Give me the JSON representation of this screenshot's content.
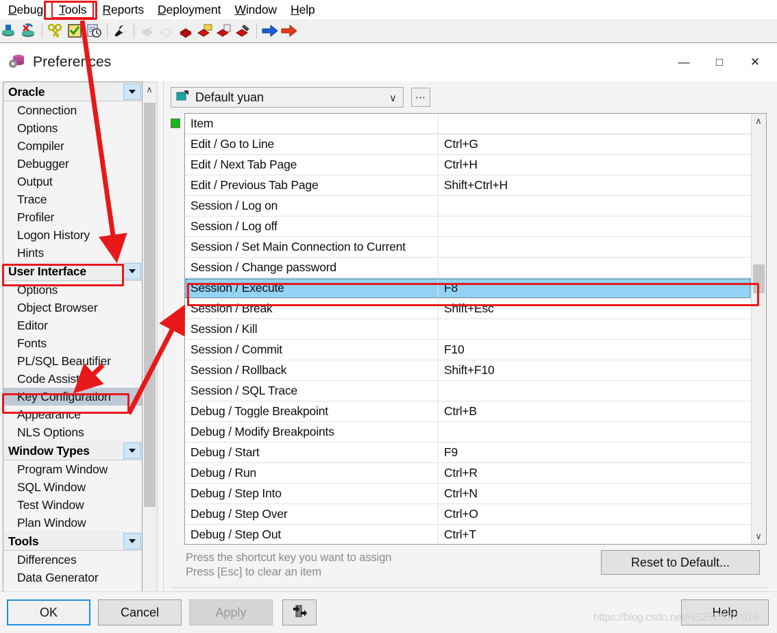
{
  "app": {
    "menubar": [
      {
        "label": "Debug",
        "accel": "D",
        "highlighted": false
      },
      {
        "label": "Tools",
        "accel": "T",
        "highlighted": true
      },
      {
        "label": "Reports",
        "accel": "R",
        "highlighted": false
      },
      {
        "label": "Deployment",
        "accel": "D",
        "highlighted": false
      },
      {
        "label": "Window",
        "accel": "W",
        "highlighted": false
      },
      {
        "label": "Help",
        "accel": "H",
        "highlighted": false
      }
    ],
    "toolbar_icons": [
      "save-icon",
      "save-all-icon",
      "sep",
      "keys-icon",
      "test-script-icon",
      "explain-plan-icon",
      "sep",
      "wrench-icon",
      "sep",
      "new-object-disabled-icon",
      "open-disabled-icon",
      "books-icon",
      "book-folder-icon",
      "book-copy-icon",
      "book-brush-icon",
      "sep",
      "blue-arrow-right-icon",
      "red-arrow-right-icon"
    ]
  },
  "dialog": {
    "title": "Preferences",
    "icon": "database-preferences-icon",
    "window_controls": {
      "minimize": "—",
      "maximize": "□",
      "close": "✕"
    }
  },
  "sidebar": {
    "scroll_up_label": "∧",
    "scroll_down_label": "∨",
    "nodes": [
      {
        "type": "group",
        "label": "Oracle",
        "expanded": true
      },
      {
        "type": "leaf",
        "label": "Connection"
      },
      {
        "type": "leaf",
        "label": "Options"
      },
      {
        "type": "leaf",
        "label": "Compiler"
      },
      {
        "type": "leaf",
        "label": "Debugger"
      },
      {
        "type": "leaf",
        "label": "Output"
      },
      {
        "type": "leaf",
        "label": "Trace"
      },
      {
        "type": "leaf",
        "label": "Profiler"
      },
      {
        "type": "leaf",
        "label": "Logon History"
      },
      {
        "type": "leaf",
        "label": "Hints"
      },
      {
        "type": "group",
        "label": "User Interface",
        "expanded": true,
        "annotated": true
      },
      {
        "type": "leaf",
        "label": "Options"
      },
      {
        "type": "leaf",
        "label": "Object Browser"
      },
      {
        "type": "leaf",
        "label": "Editor"
      },
      {
        "type": "leaf",
        "label": "Fonts"
      },
      {
        "type": "leaf",
        "label": "PL/SQL Beautifier"
      },
      {
        "type": "leaf",
        "label": "Code Assistant"
      },
      {
        "type": "leaf",
        "label": "Key Configuration",
        "selected": true,
        "annotated": true
      },
      {
        "type": "leaf",
        "label": "Appearance"
      },
      {
        "type": "leaf",
        "label": "NLS Options"
      },
      {
        "type": "group",
        "label": "Window Types",
        "expanded": true
      },
      {
        "type": "leaf",
        "label": "Program Window"
      },
      {
        "type": "leaf",
        "label": "SQL Window"
      },
      {
        "type": "leaf",
        "label": "Test Window"
      },
      {
        "type": "leaf",
        "label": "Plan Window"
      },
      {
        "type": "group",
        "label": "Tools",
        "expanded": true
      },
      {
        "type": "leaf",
        "label": "Differences"
      },
      {
        "type": "leaf",
        "label": "Data Generator"
      }
    ]
  },
  "content": {
    "profile": {
      "icon": "preference-set-icon",
      "value": "Default yuan",
      "chevron": "∨",
      "browse_label": "⋯"
    },
    "status_indicator": "green-status-square",
    "table": {
      "columns": [
        "Item",
        ""
      ],
      "rows": [
        {
          "item": "Edit / Go to Line",
          "key": "Ctrl+G"
        },
        {
          "item": "Edit / Next Tab Page",
          "key": "Ctrl+H"
        },
        {
          "item": "Edit / Previous Tab Page",
          "key": "Shift+Ctrl+H"
        },
        {
          "item": "Session / Log on",
          "key": ""
        },
        {
          "item": "Session / Log off",
          "key": ""
        },
        {
          "item": "Session / Set Main Connection to Current",
          "key": ""
        },
        {
          "item": "Session / Change password",
          "key": ""
        },
        {
          "item": "Session / Execute",
          "key": "F8",
          "selected": true
        },
        {
          "item": "Session / Break",
          "key": "Shift+Esc"
        },
        {
          "item": "Session / Kill",
          "key": ""
        },
        {
          "item": "Session / Commit",
          "key": "F10"
        },
        {
          "item": "Session / Rollback",
          "key": "Shift+F10"
        },
        {
          "item": "Session / SQL Trace",
          "key": ""
        },
        {
          "item": "Debug / Toggle Breakpoint",
          "key": "Ctrl+B"
        },
        {
          "item": "Debug / Modify Breakpoints",
          "key": ""
        },
        {
          "item": "Debug / Start",
          "key": "F9"
        },
        {
          "item": "Debug / Run",
          "key": "Ctrl+R"
        },
        {
          "item": "Debug / Step Into",
          "key": "Ctrl+N"
        },
        {
          "item": "Debug / Step Over",
          "key": "Ctrl+O"
        },
        {
          "item": "Debug / Step Out",
          "key": "Ctrl+T"
        }
      ],
      "scroll_up_label": "∧",
      "scroll_down_label": "∨"
    },
    "hint_line1": "Press the shortcut key you want to assign",
    "hint_line2": "Press [Esc] to clear an item",
    "reset_button": "Reset to Default..."
  },
  "footer": {
    "ok": "OK",
    "cancel": "Cancel",
    "apply": "Apply",
    "export_icon": "import-export-icon",
    "help": "Help"
  },
  "watermark": "https://blog.csdn.net/HS2529077916",
  "colors": {
    "annotation_red": "#e8181a",
    "selection_blue": "#93d2f5",
    "tree_selection": "#bdc9d6",
    "group_button": "#cfe6f7",
    "status_green": "#16b816",
    "ok_focus_border": "#1e8fe0"
  }
}
